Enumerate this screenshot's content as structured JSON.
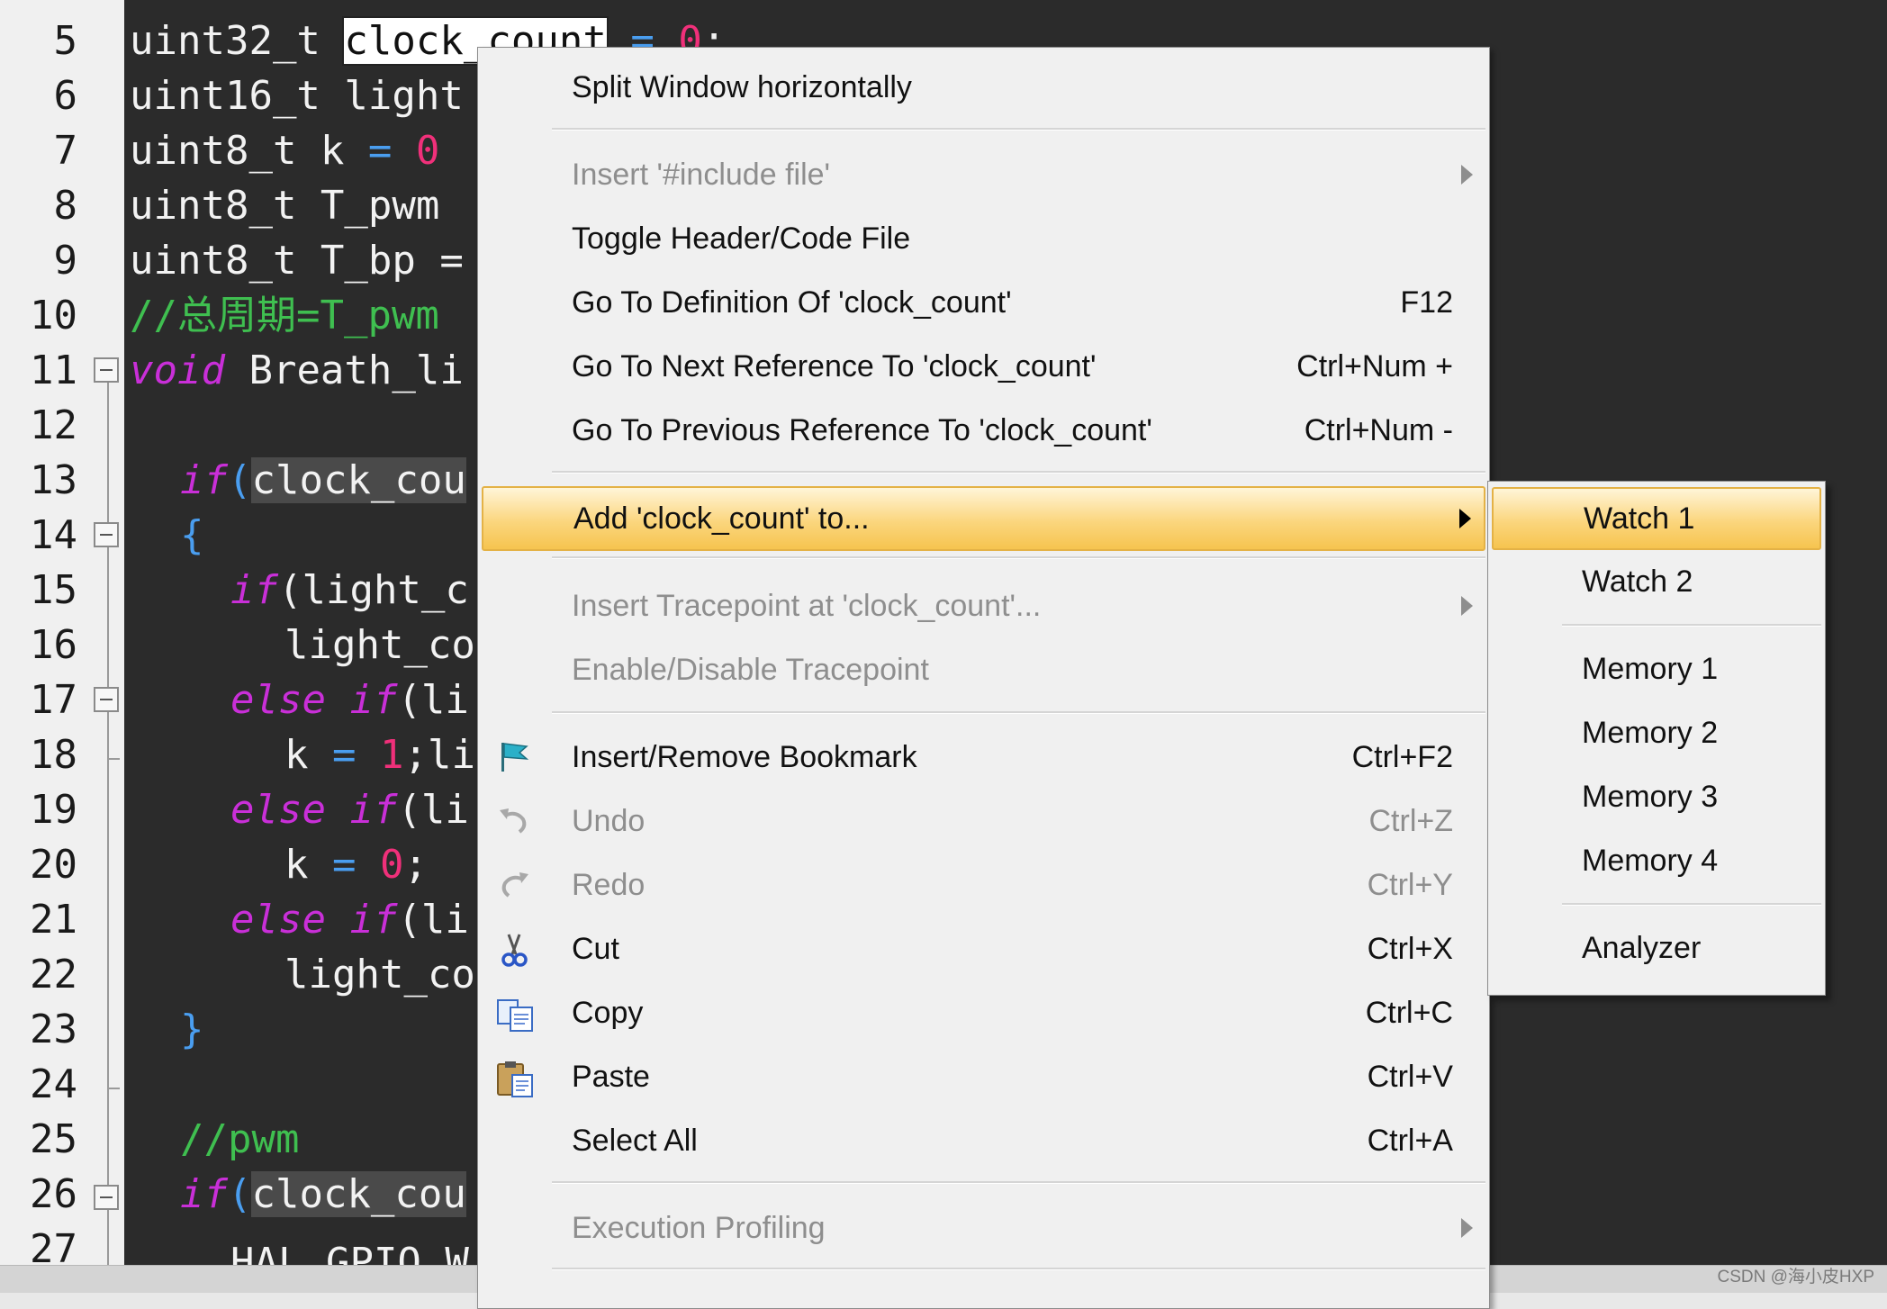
{
  "editor": {
    "line_numbers": [
      "5",
      "6",
      "7",
      "8",
      "9",
      "10",
      "11",
      "12",
      "13",
      "14",
      "15",
      "16",
      "17",
      "18",
      "19",
      "20",
      "21",
      "22",
      "23",
      "24",
      "25",
      "26",
      "27"
    ],
    "lines": {
      "l5": {
        "type": "uint32_t ",
        "sel": "clock_count",
        "rest": " = ",
        "num": "0",
        "end": ";"
      },
      "l6": {
        "text": "uint16_t light"
      },
      "l7": {
        "text": "uint8_t k ",
        "op": "=",
        "num": " 0"
      },
      "l8": {
        "text": "uint8_t T_pwm"
      },
      "l9": {
        "text": "uint8_t T_bp ="
      },
      "l10": {
        "comment": "//总周期=T_pwm"
      },
      "l11": {
        "kw": "void",
        "text": " Breath_li"
      },
      "l13": {
        "kw": "if",
        "paren": "(",
        "hl": "clock_cou"
      },
      "l14": {
        "brace": "{"
      },
      "l15": {
        "kw": "if",
        "text": "(light_c"
      },
      "l16": {
        "text": "light_co"
      },
      "l17": {
        "kw": "else if",
        "text": "(li"
      },
      "l18": {
        "pre": "k ",
        "op": "=",
        "num": " 1",
        "text": ";li"
      },
      "l19": {
        "kw": "else if",
        "text": "(li"
      },
      "l20": {
        "pre": "k ",
        "op": "=",
        "num": " 0",
        "text": ";"
      },
      "l21": {
        "kw": "else if",
        "text": "(li"
      },
      "l22": {
        "text": "light_co"
      },
      "l23": {
        "brace": "}"
      },
      "l25": {
        "comment": "//pwm"
      },
      "l26": {
        "kw": "if",
        "paren": "(",
        "hl": "clock_cou"
      },
      "l27": {
        "text": "HAL_GPIO_W"
      }
    }
  },
  "context_menu": {
    "items": [
      {
        "label": "Split Window horizontally",
        "shortcut": "",
        "enabled": true
      },
      {
        "label": "Insert '#include file'",
        "shortcut": "",
        "enabled": false,
        "submenu": true
      },
      {
        "label": "Toggle Header/Code File",
        "shortcut": "",
        "enabled": true
      },
      {
        "label": "Go To Definition Of 'clock_count'",
        "shortcut": "F12",
        "enabled": true
      },
      {
        "label": "Go To Next Reference To 'clock_count'",
        "shortcut": "Ctrl+Num +",
        "enabled": true
      },
      {
        "label": "Go To Previous Reference To 'clock_count'",
        "shortcut": "Ctrl+Num -",
        "enabled": true
      },
      {
        "label": "Add 'clock_count' to...",
        "shortcut": "",
        "enabled": true,
        "submenu": true,
        "highlighted": true
      },
      {
        "label": "Insert Tracepoint at 'clock_count'...",
        "shortcut": "",
        "enabled": false,
        "submenu": true
      },
      {
        "label": "Enable/Disable Tracepoint",
        "shortcut": "",
        "enabled": false
      },
      {
        "label": "Insert/Remove Bookmark",
        "shortcut": "Ctrl+F2",
        "enabled": true,
        "icon": "bookmark-flag-icon"
      },
      {
        "label": "Undo",
        "shortcut": "Ctrl+Z",
        "enabled": false,
        "icon": "undo-icon"
      },
      {
        "label": "Redo",
        "shortcut": "Ctrl+Y",
        "enabled": false,
        "icon": "redo-icon"
      },
      {
        "label": "Cut",
        "shortcut": "Ctrl+X",
        "enabled": true,
        "icon": "scissors-icon"
      },
      {
        "label": "Copy",
        "shortcut": "Ctrl+C",
        "enabled": true,
        "icon": "copy-icon"
      },
      {
        "label": "Paste",
        "shortcut": "Ctrl+V",
        "enabled": true,
        "icon": "paste-clipboard-icon"
      },
      {
        "label": "Select All",
        "shortcut": "Ctrl+A",
        "enabled": true
      },
      {
        "label": "Execution Profiling",
        "shortcut": "",
        "enabled": false,
        "submenu": true
      }
    ]
  },
  "submenu": {
    "items": [
      {
        "label": "Watch 1",
        "highlighted": true
      },
      {
        "label": "Watch 2"
      },
      {
        "label": "Memory 1"
      },
      {
        "label": "Memory 2"
      },
      {
        "label": "Memory 3"
      },
      {
        "label": "Memory 4"
      },
      {
        "label": "Analyzer"
      }
    ]
  },
  "watermark": "CSDN @海小皮HXP",
  "colors": {
    "keyword": "#c92fd8",
    "number": "#f0307a",
    "comment": "#3fbf50",
    "operator": "#4a9ef0",
    "menu_highlight": "#fbd67e"
  }
}
